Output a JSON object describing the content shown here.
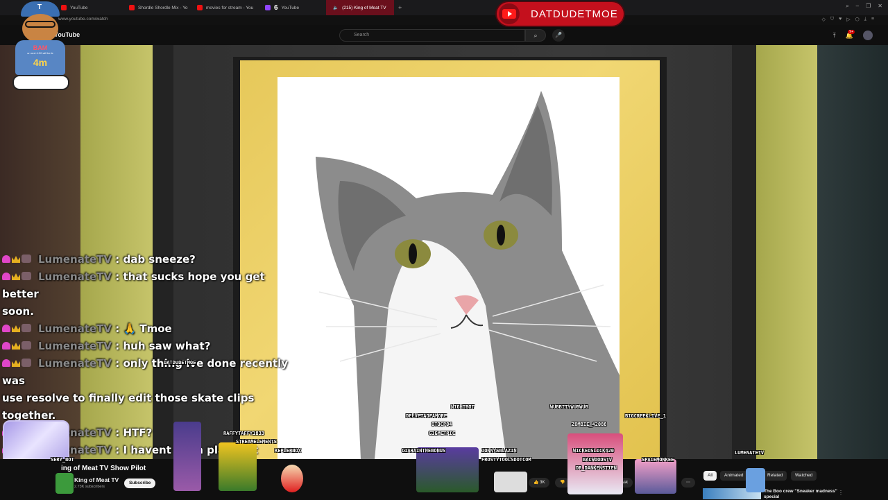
{
  "browser": {
    "tabs": [
      {
        "label": "YouTube",
        "icon": "youtube-icon"
      },
      {
        "label": "Shordle Shordle Mix - Yo",
        "icon": "youtube-icon"
      },
      {
        "label": "movies for stream - You",
        "icon": "youtube-icon"
      },
      {
        "label": "YouTube",
        "icon": "twitch-icon",
        "count": "6"
      },
      {
        "label": "(215) King of Meat TV",
        "icon": "audio-icon",
        "active": true
      }
    ],
    "url": "www.youtube.com/watch"
  },
  "youtube": {
    "logo_text": "YouTube",
    "search_placeholder": "Search",
    "notif_badge": "9+"
  },
  "overlay": {
    "channel_pill": "DATDUDETMOE",
    "avatar": {
      "hat": "T",
      "shirt_top": "BAM",
      "shirt_small": "ur next 4:20 will be le",
      "timer": "4m"
    }
  },
  "chat": {
    "messages": [
      {
        "user": "LumenateTV",
        "text": ": dab sneeze?"
      },
      {
        "user": "LumenateTV",
        "text": ": that sucks hope you get better",
        "wrap": "soon."
      },
      {
        "user": "LumenateTV",
        "text": ": 🙏 Tmoe"
      },
      {
        "user": "LumenateTV",
        "text": ": huh saw what?"
      },
      {
        "user": "LumenateTV",
        "text": ": only thing ive done recently was",
        "wrap": "use resolve to finally edit those skate clips together."
      },
      {
        "user": "LumenateTV",
        "text": ": HTF?"
      },
      {
        "user": "LumenateTV",
        "text": ": I havent even played it today..."
      }
    ]
  },
  "bots": {
    "datdudetmoe": "DATDUDETMOE",
    "nightbot": "NIGHTBOT",
    "delve": "DELVETADEAMORE",
    "otocp": "OTOCP04",
    "gigmetric": "GIGMETRIC",
    "wubbity": "WUBBITYWUBWUB",
    "zombie": "ZOMBIE_42088",
    "bigcreek": "BIGCREEKLIVE_1",
    "lumenate": "LUMENATETV",
    "raffy": "RAFFYTAFFY1833",
    "stream": "STREAMELEMENTS",
    "kepler": "KEPLERBOX",
    "ciara": "CIARAINTHEBONUS",
    "jonny": "JONNYSBLAZIN",
    "frosty": "FROSTYTOOLSDOTCOM",
    "wicked": "WICKEDSLICK420",
    "backwoods": "BACWOODSTV",
    "drbank": "DR_DANKENSTIEN",
    "spacemonkee": "SPACEMONKEE",
    "sery": "SERY_BOT"
  },
  "video": {
    "title": "ing of Meat TV Show Pilot",
    "channel": "King of Meat TV",
    "subscribers": "2.73K subscribers",
    "subscribe": "Subscribe",
    "likes": "3K",
    "ask": "Ask"
  },
  "recs": {
    "chips": [
      "All",
      "Animated",
      "Related",
      "Watched"
    ],
    "first_title": "The Boo crew \"Sneaker madness\" special"
  }
}
